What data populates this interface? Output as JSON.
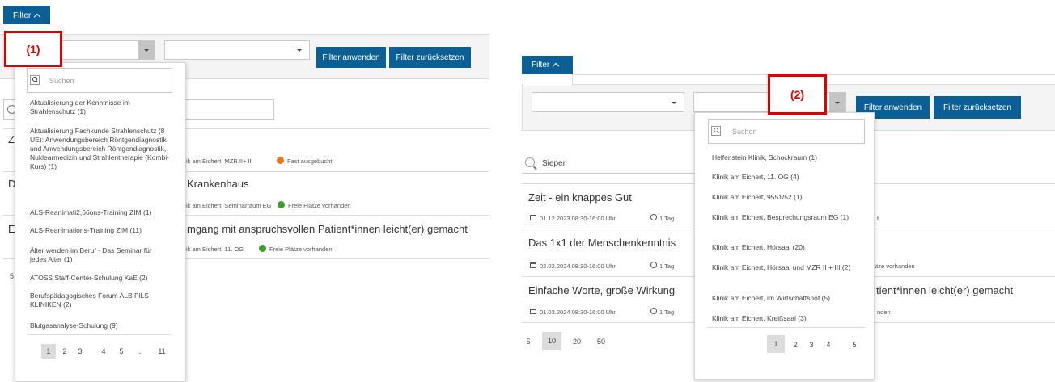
{
  "filter_label": "Filter",
  "apply_label": "Filter anwenden",
  "reset_label": "Filter zurücksetzen",
  "search_placeholder": "Suchen",
  "callouts": {
    "one": "(1)",
    "two": "(2)"
  },
  "colors": {
    "brand_blue": "#0b5f95",
    "callout_red": "#e00000",
    "status_orange": "#e87722",
    "status_green": "#3aa12c"
  },
  "left": {
    "dropdown_items": [
      "Aktualisierung der Kenntnisse im Strahlenschutz (1)",
      "Aktualisierung Fachkunde Strahlenschutz (8 UE): Anwendungsbereich Röntgendiagnostik und Anwendungsbereich Röntgendiagnostik, Nuklearmedizin und Strahlentherapie (Kombi-Kurs) (1)",
      "ALS-Reanimati2,66ons-Training ZIM (1)",
      "ALS-Reanimations-Training ZIM (11)",
      "Älter werden im Beruf - Das Seminar für jedes Alter (1)",
      "ATOSS Staff-Center-Schulung KaE (2)",
      "Berufspädagogisches Forum ALB FILS KLINIKEN (2)",
      "Blutgasanalyse-Schulung (9)"
    ],
    "pagination": [
      "1",
      "2",
      "3",
      "4",
      "5",
      "...",
      "11"
    ],
    "bg_fragments": {
      "row1_letter": "Z",
      "row1_meta": "ik am Eichert, MZR II+ III",
      "row1_status": "Fast ausgebucht",
      "row2_letter": "D",
      "row2_title": "Krankenhaus",
      "row2_meta": "ik am Eichert, Seminarraum EG",
      "row2_status": "Freie Plätze vorhanden",
      "row3_letter": "E",
      "row3_title": "mgang mit anspruchsvollen Patient*innen leicht(er) gemacht",
      "row3_meta": "ik am Eichert, 11. OG",
      "row3_status": "Freie Plätze vorhanden",
      "per_page_fragment": "5"
    }
  },
  "right": {
    "search_value": "Sieper",
    "dropdown_items": [
      "Helfenstein Klinik, Schockraum (1)",
      "Klinik am Eichert, 11. OG (4)",
      "Klinik am Eichert, 9551/52 (1)",
      "Klinik am Eichert, Besprechungsraum EG (1)",
      "Klinik am Eichert, Hörsaal (20)",
      "Klinik am Eichert, Hörsaal und MZR II + III (2)",
      "Klinik am Eichert, im Wirtschaftshof (5)",
      "Klinik am Eichert, Kreißsaal (3)"
    ],
    "pagination": [
      "1",
      "2",
      "3",
      "4",
      "5"
    ],
    "per_page": [
      "5",
      "10",
      "20",
      "50"
    ],
    "per_page_selected": "10",
    "results": [
      {
        "title": "Zeit - ein knappes Gut",
        "date": "01.12.2023 08:30-16:00 Uhr",
        "duration": "1 Tag",
        "tail": "t"
      },
      {
        "title": "Das 1x1 der Menschenkenntnis",
        "date": "02.02.2024 08:30-16:00 Uhr",
        "duration": "1 Tag",
        "tail": "ätze vorhanden"
      },
      {
        "title": "Einfache Worte, große Wirkung",
        "date": "01.03.2024 08:30-16:00 Uhr",
        "duration": "1 Tag",
        "tail": "nden"
      }
    ],
    "row3_title_tail": "tient*innen leicht(er) gemacht"
  }
}
